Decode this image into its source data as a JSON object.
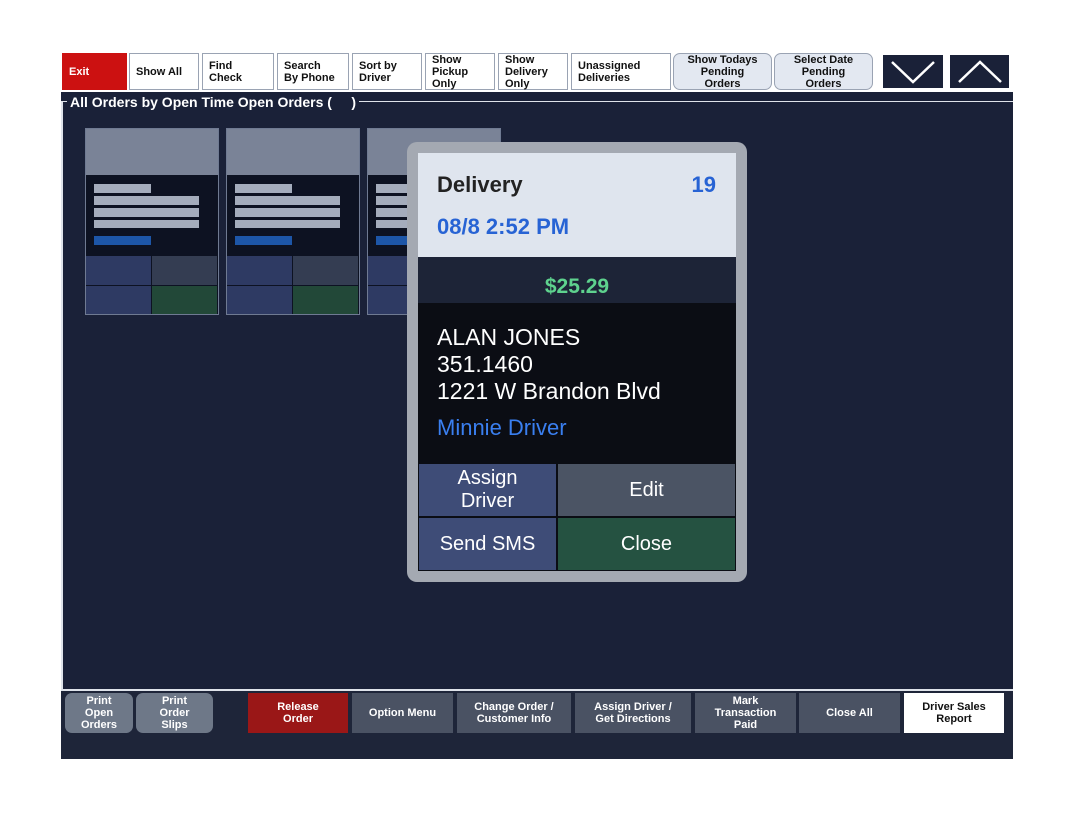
{
  "toolbar": {
    "exit": "Exit",
    "show_all": "Show All",
    "find_check": "Find\nCheck",
    "search_phone": "Search\nBy Phone",
    "sort_driver": "Sort by\nDriver",
    "show_pickup": "Show\nPickup\nOnly",
    "show_delivery": "Show\nDelivery\nOnly",
    "unassigned": "Unassigned\nDeliveries",
    "todays_pending": "Show Todays\nPending\nOrders",
    "select_date": "Select Date\nPending\nOrders"
  },
  "section": {
    "title": "All Orders by Open Time Open Orders (     )"
  },
  "popup": {
    "type": "Delivery",
    "number": "19",
    "date": "08/8 2:52 PM",
    "amount": "$25.29",
    "customer_name": "ALAN JONES",
    "phone": "351.1460",
    "address": "1221 W Brandon Blvd",
    "driver": "Minnie Driver",
    "assign_driver": "Assign\nDriver",
    "edit": "Edit",
    "send_sms": "Send SMS",
    "close": "Close"
  },
  "bottom": {
    "print_open": "Print\nOpen\nOrders",
    "print_slips": "Print\nOrder\nSlips",
    "release": "Release\nOrder",
    "option_menu": "Option Menu",
    "change_order": "Change Order /\nCustomer Info",
    "assign_directions": "Assign Driver /\nGet Directions",
    "mark_paid": "Mark\nTransaction\nPaid",
    "close_all": "Close All",
    "driver_sales": "Driver Sales\nReport"
  },
  "colors": {
    "background": "#1a2138",
    "exit_red": "#cc1111",
    "accent_blue": "#2763d4",
    "amount_green": "#5ed28e",
    "close_green": "#255241"
  },
  "icons": {
    "scroll_down": "chevron-down-icon",
    "scroll_up": "chevron-up-icon"
  }
}
